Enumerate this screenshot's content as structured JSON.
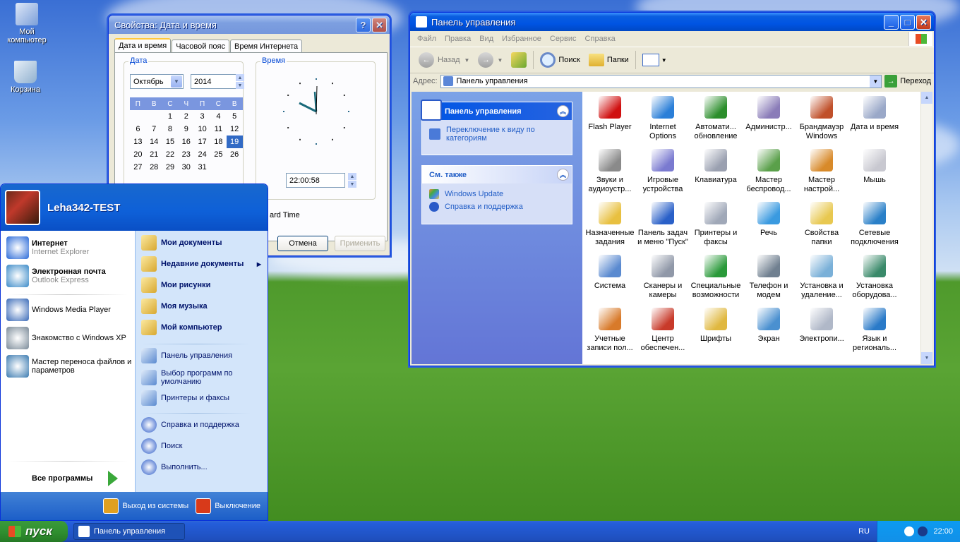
{
  "desktop": {
    "icons": [
      {
        "label": "Мой компьютер",
        "icon": "my-computer-icon"
      },
      {
        "label": "Корзина",
        "icon": "recycle-bin-icon"
      }
    ]
  },
  "datetime_window": {
    "title": "Свойства: Дата и время",
    "title_buttons": {
      "help": "?",
      "close": "✕"
    },
    "tabs": [
      "Дата и время",
      "Часовой пояс",
      "Время Интернета"
    ],
    "date_group": "Дата",
    "month": "Октябрь",
    "year": "2014",
    "weekdays": [
      "П",
      "В",
      "С",
      "Ч",
      "П",
      "С",
      "В"
    ],
    "calendar_rows": [
      [
        "",
        "",
        "1",
        "2",
        "3",
        "4",
        "5"
      ],
      [
        "6",
        "7",
        "8",
        "9",
        "10",
        "11",
        "12"
      ],
      [
        "13",
        "14",
        "15",
        "16",
        "17",
        "18",
        "19"
      ],
      [
        "20",
        "21",
        "22",
        "23",
        "24",
        "25",
        "26"
      ],
      [
        "27",
        "28",
        "29",
        "30",
        "31",
        "",
        ""
      ]
    ],
    "selected_day": "19",
    "time_group": "Время",
    "time_value": "22:00:58",
    "timezone_fragment": "ard Time",
    "buttons": {
      "cancel": "Отмена",
      "apply": "Применить"
    }
  },
  "control_panel": {
    "title": "Панель управления",
    "menu": [
      "Файл",
      "Правка",
      "Вид",
      "Избранное",
      "Сервис",
      "Справка"
    ],
    "toolbar": {
      "back": "Назад",
      "search": "Поиск",
      "folders": "Папки"
    },
    "address_label": "Адрес:",
    "address_value": "Панель управления",
    "go_label": "Переход",
    "taskpane": {
      "main_title": "Панель управления",
      "switch_link": "Переключение к виду по категориям",
      "see_also_title": "См. также",
      "see_also_links": [
        "Windows Update",
        "Справка и поддержка"
      ]
    },
    "items": [
      {
        "label": "Flash Player",
        "icon": "flash-player-icon",
        "color": "#d01010"
      },
      {
        "label": "Internet Options",
        "icon": "internet-options-icon",
        "color": "#2b7fd8"
      },
      {
        "label": "Автомати... обновление",
        "icon": "windows-update-icon",
        "color": "#2c8e2c"
      },
      {
        "label": "Администр...",
        "icon": "admin-tools-icon",
        "color": "#8a7cb8"
      },
      {
        "label": "Брандмауэр Windows",
        "icon": "firewall-icon",
        "color": "#c0502a"
      },
      {
        "label": "Дата и время",
        "icon": "date-time-icon",
        "color": "#9aa8c8"
      },
      {
        "label": "Звуки и аудиоустр...",
        "icon": "sound-icon",
        "color": "#8a8a8a"
      },
      {
        "label": "Игровые устройства",
        "icon": "game-controller-icon",
        "color": "#7a7ad0"
      },
      {
        "label": "Клавиатура",
        "icon": "keyboard-icon",
        "color": "#9aa0b0"
      },
      {
        "label": "Мастер беспровод...",
        "icon": "wireless-icon",
        "color": "#5aa04a"
      },
      {
        "label": "Мастер настрой...",
        "icon": "network-setup-icon",
        "color": "#d88a2a"
      },
      {
        "label": "Мышь",
        "icon": "mouse-icon",
        "color": "#c8c8d0"
      },
      {
        "label": "Назначенные задания",
        "icon": "scheduled-tasks-icon",
        "color": "#e8c040"
      },
      {
        "label": "Панель задач и меню \"Пуск\"",
        "icon": "taskbar-icon",
        "color": "#2a60c8"
      },
      {
        "label": "Принтеры и факсы",
        "icon": "printer-icon",
        "color": "#a0a8b8"
      },
      {
        "label": "Речь",
        "icon": "speech-icon",
        "color": "#3a9ae0"
      },
      {
        "label": "Свойства папки",
        "icon": "folder-options-icon",
        "color": "#e8c850"
      },
      {
        "label": "Сетевые подключения",
        "icon": "network-connections-icon",
        "color": "#2a80c8"
      },
      {
        "label": "Система",
        "icon": "system-icon",
        "color": "#5a8ad0"
      },
      {
        "label": "Сканеры и камеры",
        "icon": "scanner-icon",
        "color": "#9098a8"
      },
      {
        "label": "Специальные возможности",
        "icon": "accessibility-icon",
        "color": "#2a9a3a"
      },
      {
        "label": "Телефон и модем",
        "icon": "phone-modem-icon",
        "color": "#708090"
      },
      {
        "label": "Установка и удаление...",
        "icon": "add-remove-programs-icon",
        "color": "#7ab0d8"
      },
      {
        "label": "Установка оборудова...",
        "icon": "add-hardware-icon",
        "color": "#3a8a6a"
      },
      {
        "label": "Учетные записи пол...",
        "icon": "user-accounts-icon",
        "color": "#d87a2a"
      },
      {
        "label": "Центр обеспечен...",
        "icon": "security-center-icon",
        "color": "#c83a2a"
      },
      {
        "label": "Шрифты",
        "icon": "fonts-icon",
        "color": "#e0b840"
      },
      {
        "label": "Экран",
        "icon": "display-icon",
        "color": "#4a90d0"
      },
      {
        "label": "Электропи...",
        "icon": "power-options-icon",
        "color": "#b0b8c8"
      },
      {
        "label": "Язык и региональ...",
        "icon": "regional-icon",
        "color": "#2a7ac8"
      }
    ]
  },
  "start_menu": {
    "user": "Leha342-TEST",
    "pinned": [
      {
        "title": "Интернет",
        "sub": "Internet Explorer",
        "icon": "internet-explorer-icon"
      },
      {
        "title": "Электронная почта",
        "sub": "Outlook Express",
        "icon": "outlook-express-icon"
      }
    ],
    "recent": [
      {
        "label": "Windows Media Player",
        "icon": "media-player-icon"
      },
      {
        "label": "Знакомство с Windows XP",
        "icon": "windows-tour-icon"
      },
      {
        "label": "Мастер переноса файлов и параметров",
        "icon": "transfer-wizard-icon"
      }
    ],
    "all_programs": "Все программы",
    "right_top": [
      {
        "label": "Мои документы",
        "icon": "my-documents-icon"
      },
      {
        "label": "Недавние документы",
        "icon": "recent-documents-icon"
      },
      {
        "label": "Мои рисунки",
        "icon": "my-pictures-icon"
      },
      {
        "label": "Моя музыка",
        "icon": "my-music-icon"
      },
      {
        "label": "Мой компьютер",
        "icon": "my-computer-icon"
      }
    ],
    "right_mid": [
      {
        "label": "Панель управления",
        "icon": "control-panel-icon"
      },
      {
        "label": "Выбор программ по умолчанию",
        "icon": "default-programs-icon"
      },
      {
        "label": "Принтеры и факсы",
        "icon": "printer-icon"
      }
    ],
    "right_bottom": [
      {
        "label": "Справка и поддержка",
        "icon": "help-icon"
      },
      {
        "label": "Поиск",
        "icon": "search-icon"
      },
      {
        "label": "Выполнить...",
        "icon": "run-icon"
      }
    ],
    "logoff": "Выход из системы",
    "shutdown": "Выключение"
  },
  "taskbar": {
    "start": "пуск",
    "task": "Панель управления",
    "lang": "RU",
    "clock": "22:00"
  }
}
